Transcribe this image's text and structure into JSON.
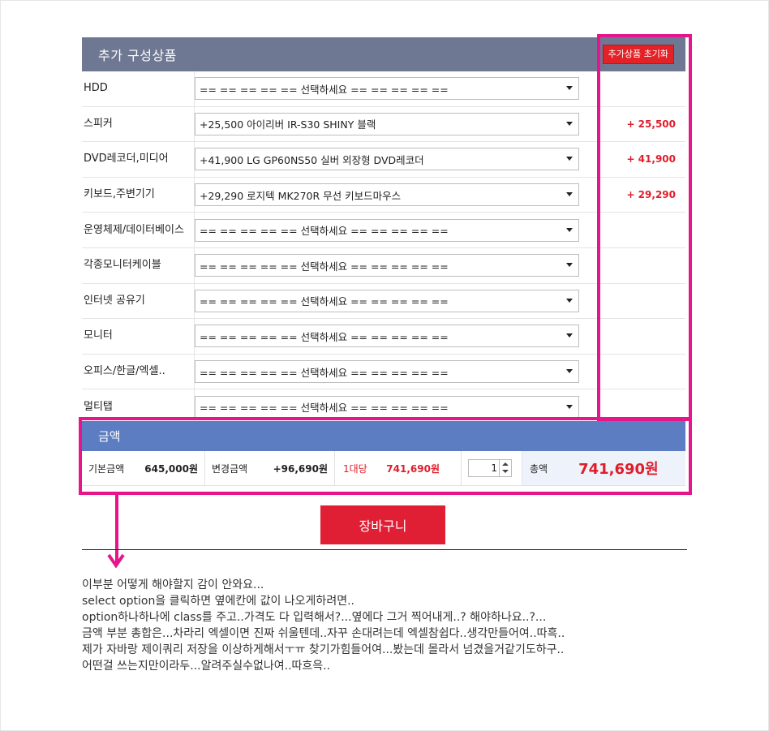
{
  "options": {
    "title": "추가 구성상품",
    "reset_button": "추가상품 초기화",
    "rows": [
      {
        "label": "HDD",
        "selected": "== == == == == 선택하세요 == == == == ==",
        "price": ""
      },
      {
        "label": "스피커",
        "selected": "+25,500 아이리버 IR-S30 SHINY 블랙",
        "price": "+ 25,500"
      },
      {
        "label": "DVD레코더,미디어",
        "selected": "+41,900 LG GP60NS50 실버 외장형 DVD레코더",
        "price": "+ 41,900"
      },
      {
        "label": "키보드,주변기기",
        "selected": "+29,290 로지텍 MK270R 무선 키보드마우스",
        "price": "+ 29,290"
      },
      {
        "label": "운영체제/데이터베이스",
        "selected": "== == == == == 선택하세요 == == == == ==",
        "price": ""
      },
      {
        "label": "각종모니터케이블",
        "selected": "== == == == == 선택하세요 == == == == ==",
        "price": ""
      },
      {
        "label": "인터넷 공유기",
        "selected": "== == == == == 선택하세요 == == == == ==",
        "price": ""
      },
      {
        "label": "모니터",
        "selected": "== == == == == 선택하세요 == == == == ==",
        "price": ""
      },
      {
        "label": "오피스/한글/엑셀..",
        "selected": "== == == == == 선택하세요 == == == == ==",
        "price": ""
      },
      {
        "label": "멀티탭",
        "selected": "== == == == == 선택하세요 == == == == ==",
        "price": ""
      }
    ]
  },
  "amount": {
    "title": "금액",
    "base_label": "기본금액",
    "base_value": "645,000원",
    "change_label": "변경금액",
    "change_value": "+96,690원",
    "per_unit_label": "1대당",
    "per_unit_value": "741,690원",
    "quantity": "1",
    "total_label": "총액",
    "total_value": "741,690원"
  },
  "cart_button": "장바구니",
  "note_lines": [
    "이부분 어떻게 해야할지 감이 안와요...",
    "select option을 클릭하면 옆에칸에 값이 나오게하려면..",
    "option하나하나에 class를 주고..가격도 다 입력해서?...옆에다 그거 찍어내게..? 해야하나요..?...",
    "금액 부분 총합은...차라리 엑셀이면 진짜 쉬울텐데..자꾸 손대려는데 엑셀참쉽다..생각만들어여..따흑..",
    "제가 자바랑 제이쿼리 저장을 이상하게해서ㅜㅠ 찾기가힘들어여...봤는데 몰라서 넘겼을거같기도하구..",
    "어떤걸 쓰는지만이라두...알려주실수없나여..따흐윽.."
  ],
  "colors": {
    "header_gray": "#6f7893",
    "header_blue": "#5c7dc1",
    "accent_red": "#e01e2b",
    "annotation_pink": "#e6158c"
  }
}
